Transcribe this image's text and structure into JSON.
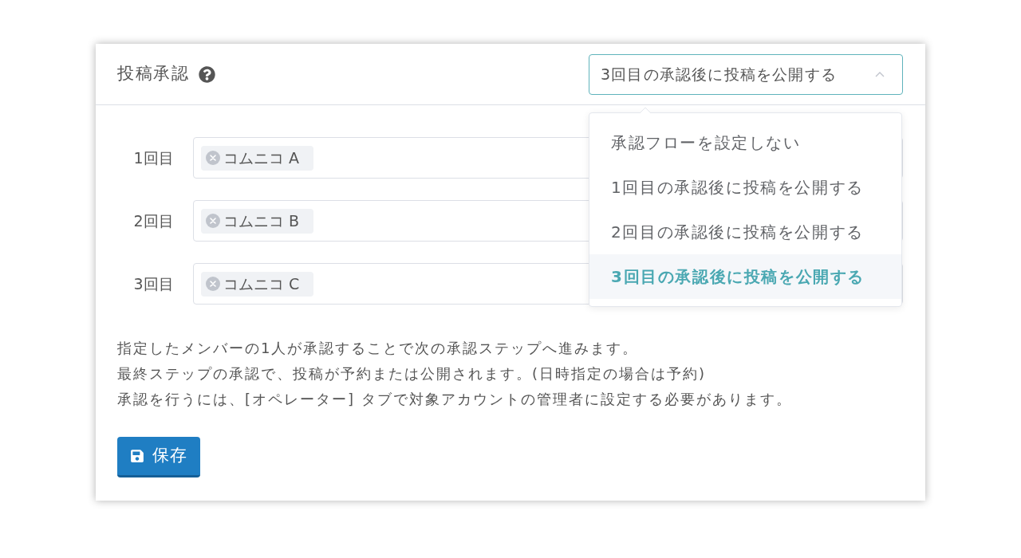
{
  "section": {
    "title": "投稿承認"
  },
  "select": {
    "value": "3回目の承認後に投稿を公開する",
    "expanded": true
  },
  "dropdown": {
    "options": [
      {
        "label": "承認フローを設定しない",
        "selected": false
      },
      {
        "label": "1回目の承認後に投稿を公開する",
        "selected": false
      },
      {
        "label": "2回目の承認後に投稿を公開する",
        "selected": false
      },
      {
        "label": "3回目の承認後に投稿を公開する",
        "selected": true
      }
    ]
  },
  "steps": [
    {
      "label": "1回目",
      "approvers": [
        {
          "name": "コムニコ A"
        }
      ]
    },
    {
      "label": "2回目",
      "approvers": [
        {
          "name": "コムニコ B"
        }
      ]
    },
    {
      "label": "3回目",
      "approvers": [
        {
          "name": "コムニコ C"
        }
      ]
    }
  ],
  "notes": [
    "指定したメンバーの1人が承認することで次の承認ステップへ進みます。",
    "最終ステップの承認で、投稿が予約または公開されます。(日時指定の場合は予約)",
    "承認を行うには、[オペレーター] タブで対象アカウントの管理者に設定する必要があります。"
  ],
  "save_button": {
    "label": "保存"
  }
}
